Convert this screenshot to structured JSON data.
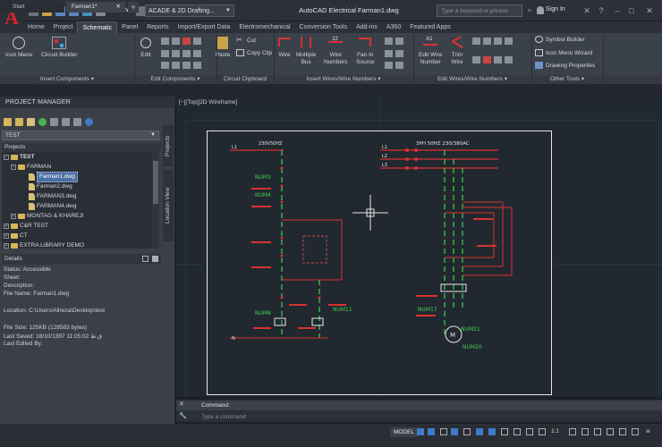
{
  "app": {
    "logo_letter": "A",
    "workspace": "ACADE & 2D Drafting...",
    "title": "AutoCAD Electrical    Farman1.dwg",
    "search_placeholder": "Type a keyword or phrase",
    "sign_in": "Sign In"
  },
  "ribbon_tabs": [
    "Home",
    "Project",
    "Schematic",
    "Panel",
    "Reports",
    "Import/Export Data",
    "Electromechanical",
    "Conversion Tools",
    "Add-ins",
    "A360",
    "Featured Apps"
  ],
  "active_tab": "Schematic",
  "ribbon": {
    "icon_menu": "Icon Menu",
    "circuit_builder": "Circuit Builder",
    "edit": "Edit",
    "paste": "Paste",
    "cut": "Cut",
    "copy_clip": "Copy Clip",
    "wire": "Wire",
    "multiple_bus": [
      "Multiple",
      "Bus"
    ],
    "wire_numbers": [
      "Wire",
      "Numbers"
    ],
    "fan_in_source": [
      "Fan In",
      "Source"
    ],
    "edit_wire_number": [
      "Edit Wire",
      "Number"
    ],
    "trim_wire": [
      "Trim",
      "Wire"
    ],
    "symbol_builder": "Symbol Builder",
    "icon_menu_wizard": "Icon Menu  Wizard",
    "drawing_properties": "Drawing  Properties"
  },
  "groups": [
    "Insert Components",
    "Edit Components",
    "Circuit Clipboard",
    "Insert Wires/Wire Numbers",
    "Edit Wires/Wire Numbers",
    "Other Tools"
  ],
  "doc_tabs": {
    "start": "Start",
    "current": "Farman1*",
    "add": "+"
  },
  "project_manager": {
    "title": "PROJECT MANAGER",
    "combo": "TEST",
    "projects_header": "Projects",
    "tree": {
      "root": "TEST",
      "folder": "FARMAN",
      "files": [
        "Farman1.dwg",
        "Farman2.dwg",
        "FARMAN3.dwg",
        "FARMAN4.dwg"
      ],
      "others": [
        "MONTAG & KHAREJI",
        "C&R TEST",
        "CT",
        "EXTRA LIBRARY DEMO"
      ]
    },
    "details_header": "Details",
    "details": [
      "Status: Accessible",
      "Sheet:",
      "Description:",
      "File Name: Farman1.dwg",
      "",
      "Location: C:\\Users\\Alireza\\Desktop\\test",
      "",
      "File Size: 125KB (128583 bytes)",
      "Last Saved: 18/10/1397 11:05:02 ق.ظ",
      "Last Edited By:"
    ],
    "side_tabs": [
      "Projects",
      "Location View"
    ]
  },
  "viewport": {
    "label": "[−][Top][2D Wireframe]"
  },
  "schematic": {
    "left_header": "230V50HZ",
    "right_header": "3PH 50HZ 230/380AC",
    "labels_left": [
      "L1",
      "NUM3",
      "NUM4",
      "NUM8",
      "NUM11",
      "N"
    ],
    "labels_right": [
      "L1",
      "L2",
      "L3",
      "NUM17",
      "NUM21",
      "NUM20"
    ],
    "motor_label": "M"
  },
  "command": {
    "label": "Command:",
    "placeholder": "Type a command"
  },
  "status": {
    "model": "MODEL",
    "scale": "1:1"
  },
  "colors": {
    "accent_red": "#d8262e",
    "wire_red": "#d9332f",
    "wire_green": "#3fd24f",
    "sheet_white": "#e8e8ea"
  }
}
